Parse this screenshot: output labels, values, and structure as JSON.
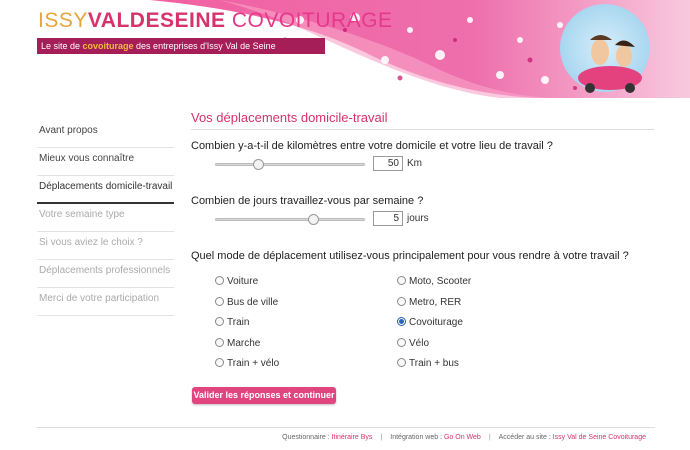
{
  "header": {
    "logo_part1": "ISSY",
    "logo_part2": "VALDESEINE",
    "logo_part3": " COVOITURAGE",
    "tagline_pre": "Le site de ",
    "tagline_highlight": "covoiturage",
    "tagline_post": " des entreprises d'Issy Val de Seine",
    "accent_color": "#d6336c"
  },
  "sidebar": {
    "items": [
      {
        "label": "Avant propos",
        "state": "done"
      },
      {
        "label": "Mieux vous connaître",
        "state": "done"
      },
      {
        "label": "Déplacements domicile-travail",
        "state": "active"
      },
      {
        "label": "Votre semaine type",
        "state": "todo"
      },
      {
        "label": "Si vous aviez le choix ?",
        "state": "todo"
      },
      {
        "label": "Déplacements professionnels",
        "state": "todo"
      },
      {
        "label": "Merci de votre participation",
        "state": "todo"
      }
    ]
  },
  "main": {
    "title": "Vos déplacements domicile-travail",
    "q1": {
      "label": "Combien y-a-t-il de kilomètres entre votre domicile et votre lieu de travail ?",
      "value": "50",
      "unit": "Km",
      "slider_fraction": 0.27
    },
    "q2": {
      "label": "Combien de jours travaillez-vous par semaine ?",
      "value": "5",
      "unit": "jours",
      "slider_fraction": 0.67
    },
    "q3": {
      "label": "Quel mode de déplacement utilisez-vous principalement pour vous rendre à votre travail ?",
      "options_left": [
        "Voiture",
        "Bus de ville",
        "Train",
        "Marche",
        "Train + vélo"
      ],
      "options_right": [
        "Moto, Scooter",
        "Metro, RER",
        "Covoiturage",
        "Vélo",
        "Train + bus"
      ],
      "selected": "Covoiturage"
    },
    "submit_label": "Valider les réponses et continuer"
  },
  "footer": {
    "q_label": "Questionnaire : ",
    "q_link": "Itinéraire Bys",
    "sep1": "|",
    "integ_label": "Intégration web : ",
    "integ_link": "Go On Web",
    "sep2": "|",
    "access_label": "Accéder au site : ",
    "access_link": "Issy Val de Seine Covoiturage"
  }
}
